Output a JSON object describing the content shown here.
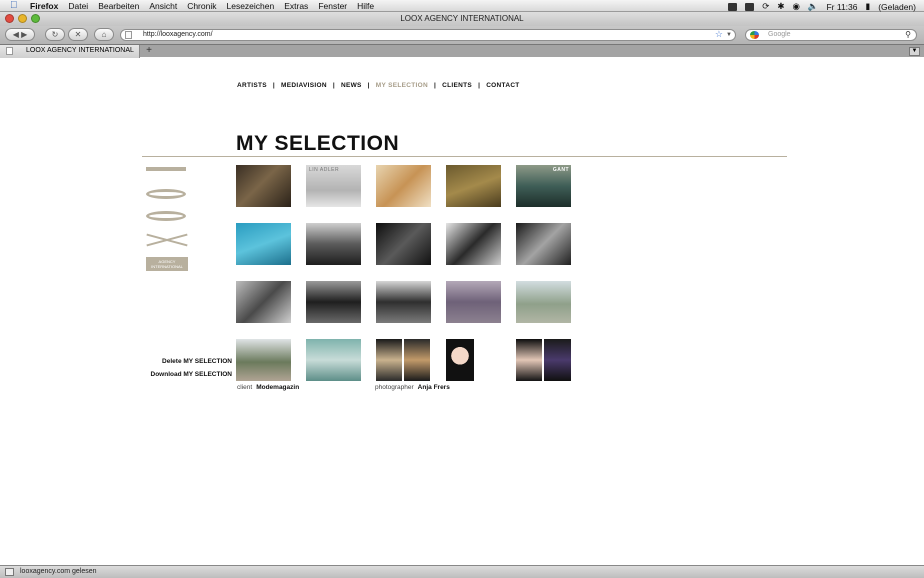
{
  "menubar": {
    "app": "Firefox",
    "items": [
      "Datei",
      "Bearbeiten",
      "Ansicht",
      "Chronik",
      "Lesezeichen",
      "Extras",
      "Fenster",
      "Hilfe"
    ],
    "clock": "Fr 11:36",
    "battery": "(Geladen)"
  },
  "window": {
    "title": "LOOX AGENCY INTERNATIONAL"
  },
  "toolbar": {
    "url": "http://looxagency.com/",
    "search_placeholder": "Google"
  },
  "tabs": [
    {
      "label": "LOOX AGENCY INTERNATIONAL"
    }
  ],
  "site": {
    "nav": [
      {
        "label": "ARTISTS",
        "active": false
      },
      {
        "label": "MEDIAVISION",
        "active": false
      },
      {
        "label": "NEWS",
        "active": false
      },
      {
        "label": "MY SELECTION",
        "active": true
      },
      {
        "label": "CLIENTS",
        "active": false
      },
      {
        "label": "CONTACT",
        "active": false
      }
    ],
    "heading": "MY SELECTION",
    "logo_badge_line1": "AGENCY",
    "logo_badge_line2": "INTERNATIONAL",
    "actions": {
      "delete": "Delete MY SELECTION",
      "download": "Download MY SELECTION"
    },
    "thumb_texts": {
      "lin_adler": "LIN ADLER",
      "gant": "GANT"
    },
    "captions": [
      {
        "key": "client",
        "value": "Modemagazin"
      },
      {
        "key": "photographer",
        "value": "Anja Frers"
      }
    ]
  },
  "status": {
    "text": "looxagency.com gelesen"
  }
}
